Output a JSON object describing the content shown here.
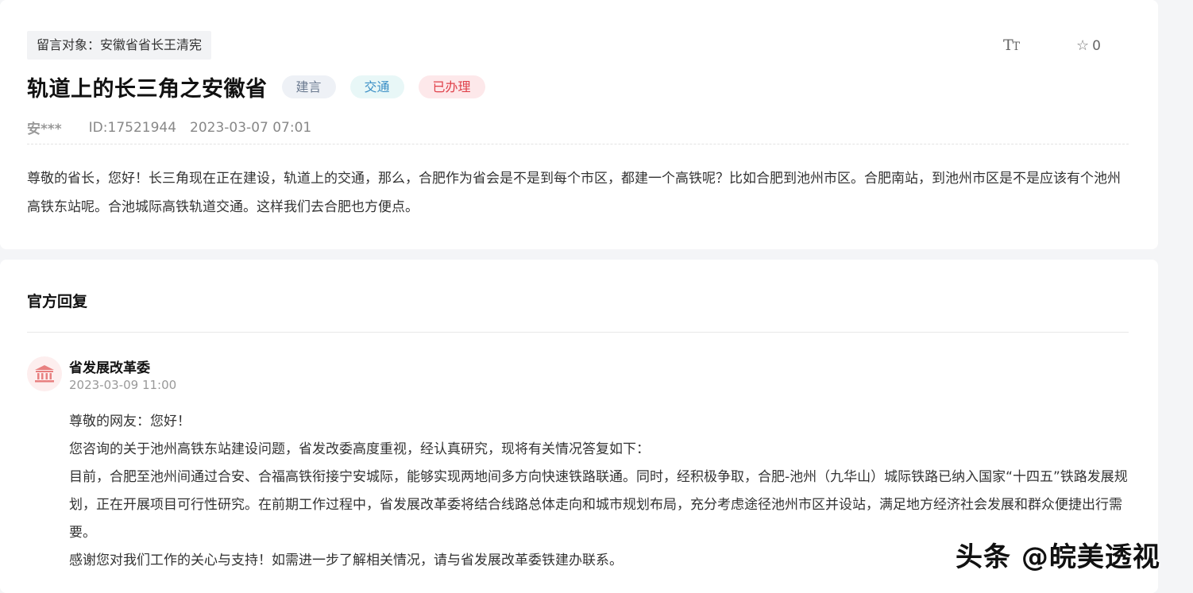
{
  "post": {
    "target": "留言对象：安徽省省长王清宪",
    "font_toggle": {
      "big": "T",
      "small": "T"
    },
    "favorite_count": "0",
    "title": "轨道上的长三角之安徽省",
    "badges": [
      "建言",
      "交通",
      "已办理"
    ],
    "author": "安***",
    "id": "ID:17521944",
    "datetime": "2023-03-07 07:01",
    "content": "尊敬的省长，您好！长三角现在正在建设，轨道上的交通，那么，合肥作为省会是不是到每个市区，都建一个高铁呢？比如合肥到池州市区。合肥南站，到池州市区是不是应该有个池州高铁东站呢。合池城际高铁轨道交通。这样我们去合肥也方便点。"
  },
  "reply": {
    "heading": "官方回复",
    "department": "省发展改革委",
    "datetime": "2023-03-09 11:00",
    "paragraphs": [
      "尊敬的网友：您好！",
      "您咨询的关于池州高铁东站建设问题，省发改委高度重视，经认真研究，现将有关情况答复如下：",
      "目前，合肥至池州间通过合安、合福高铁衔接宁安城际，能够实现两地间多方向快速铁路联通。同时，经积极争取，合肥-池州（九华山）城际铁路已纳入国家“十四五”铁路发展规划，正在开展项目可行性研究。在前期工作过程中，省发展改革委将结合线路总体走向和城市规划布局，充分考虑途径池州市区并设站，满足地方经济社会发展和群众便捷出行需要。",
      "感谢您对我们工作的关心与支持！如需进一步了解相关情况，请与省发展改革委铁建办联系。"
    ]
  },
  "watermark": "头条 @皖美透视",
  "icons": {
    "font_size": "font-size-icon",
    "favorite": "star-icon",
    "avatar": "government-building-icon"
  },
  "colors": {
    "badge_suggestion": "#6b7a90",
    "badge_traffic": "#3b8fc6",
    "badge_done": "#e0424b",
    "avatar_icon": "#e88080"
  }
}
